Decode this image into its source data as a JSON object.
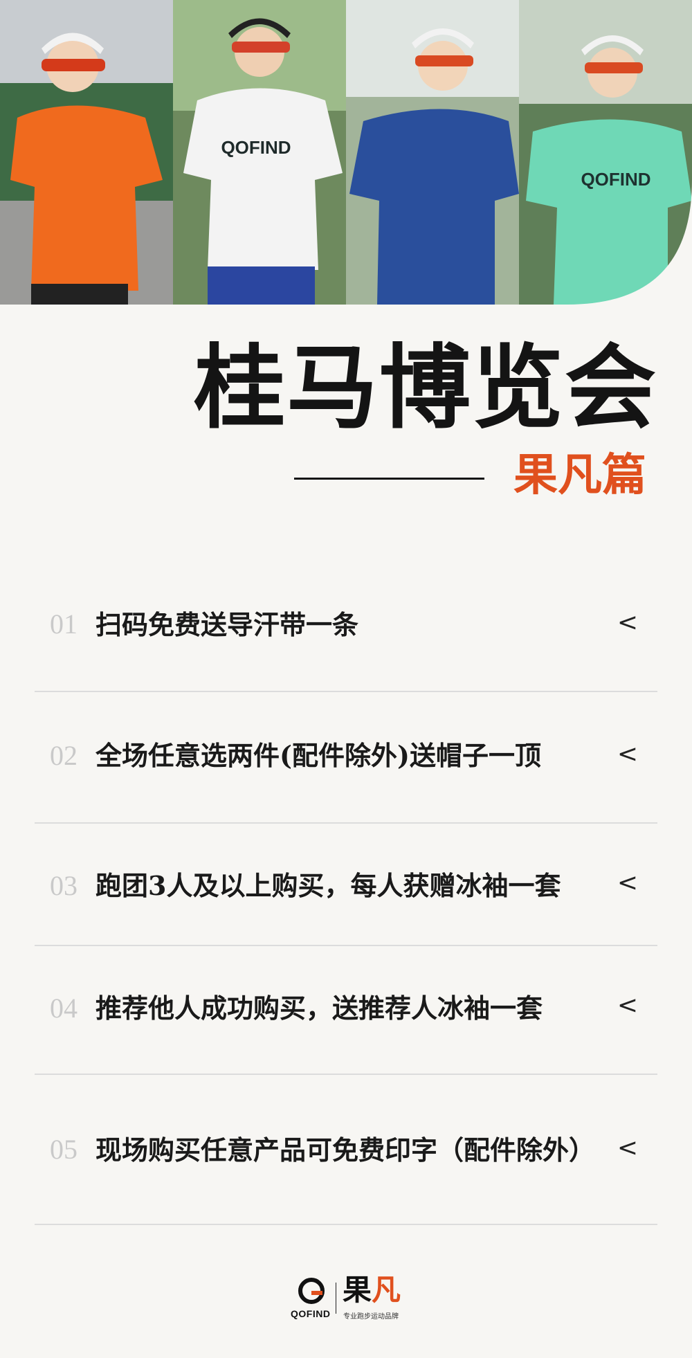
{
  "hero": {
    "runners": [
      {
        "shirt_color": "#f06a1e",
        "shirt_logo": ""
      },
      {
        "shirt_color": "#f3f3f3",
        "shirt_logo": "QOFIND"
      },
      {
        "shirt_color": "#2a4f9c",
        "shirt_logo": ""
      },
      {
        "shirt_color": "#6fd8b6",
        "shirt_logo": "QOFIND"
      }
    ]
  },
  "title": {
    "main": "桂马博览会",
    "sub": "果凡篇"
  },
  "offers": [
    {
      "num": "01",
      "text": "扫码免费送导汗带一条",
      "chevron": "<"
    },
    {
      "num": "02",
      "text": "全场任意选两件(配件除外)送帽子一顶",
      "chevron": "<"
    },
    {
      "num": "03",
      "text": "跑团3人及以上购买，每人获赠冰袖一套",
      "chevron": "<"
    },
    {
      "num": "04",
      "text": "推荐他人成功购买，送推荐人冰袖一套",
      "chevron": "<"
    },
    {
      "num": "05",
      "text": "现场购买任意产品可免费印字（配件除外）",
      "chevron": "<"
    }
  ],
  "footer": {
    "logo_word": "QOFIND",
    "cn_name_1": "果",
    "cn_name_2": "凡",
    "tagline": "专业跑步运动品牌"
  },
  "colors": {
    "accent": "#e0501e",
    "background": "#f7f6f3",
    "text": "#141414"
  }
}
